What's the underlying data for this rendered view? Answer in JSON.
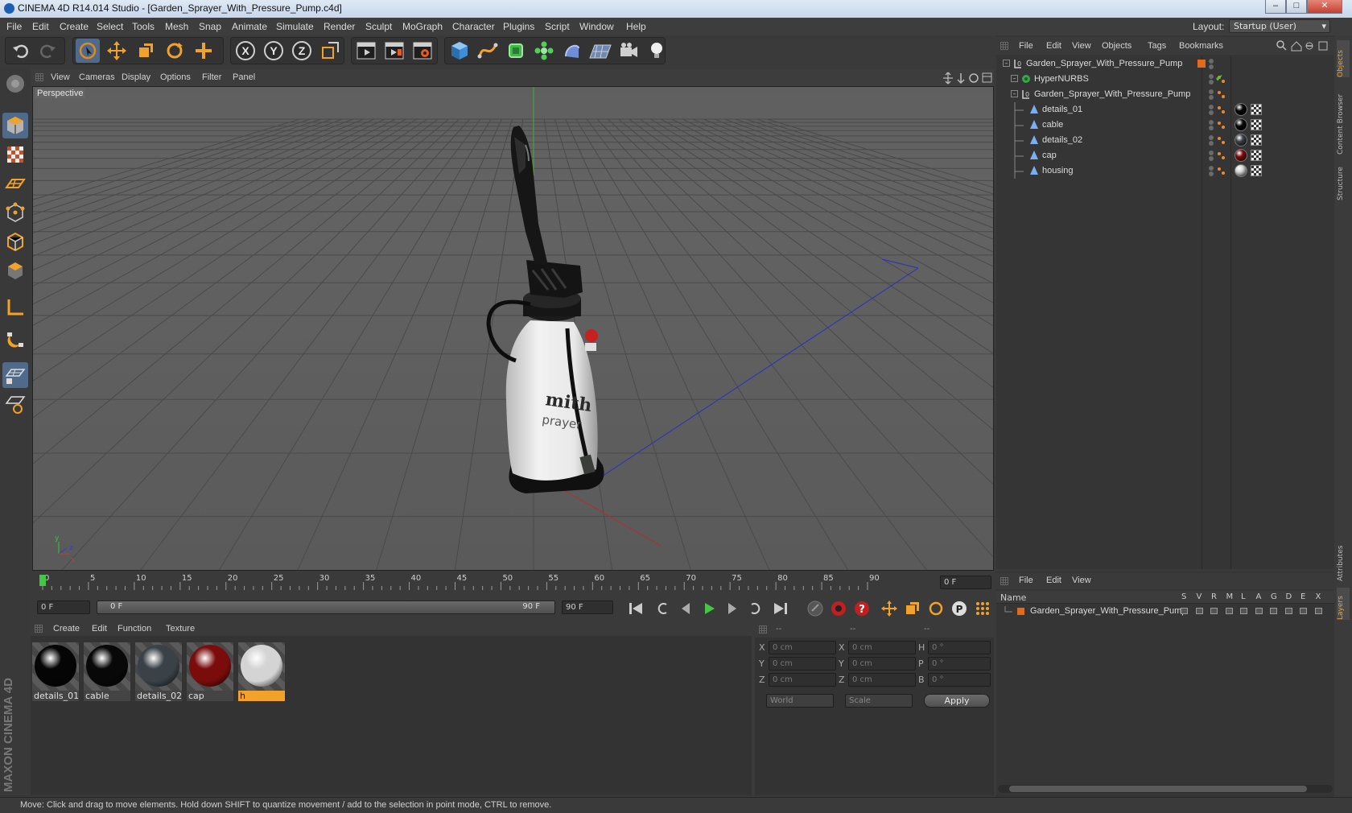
{
  "window": {
    "title": "CINEMA 4D R14.014 Studio - [Garden_Sprayer_With_Pressure_Pump.c4d]"
  },
  "menubar": {
    "items": [
      "File",
      "Edit",
      "Create",
      "Select",
      "Tools",
      "Mesh",
      "Snap",
      "Animate",
      "Simulate",
      "Render",
      "Sculpt",
      "MoGraph",
      "Character",
      "Plugins",
      "Script",
      "Window",
      "Help"
    ],
    "layout_label": "Layout:",
    "layout_value": "Startup (User)"
  },
  "toolbar": {
    "icons": [
      "undo-icon",
      "redo-icon",
      "live-selection-icon",
      "move-icon",
      "scale-icon",
      "rotate-icon",
      "add-icon",
      "x-axis-icon",
      "y-axis-icon",
      "z-axis-icon",
      "coordinate-system-icon",
      "render-view-icon",
      "render-picture-viewer-icon",
      "edit-render-settings-icon",
      "cube-icon",
      "spline-icon",
      "nurbs-icon",
      "array-icon",
      "deformer-icon",
      "floor-icon",
      "camera-icon",
      "light-icon"
    ],
    "axis_x": "X",
    "axis_y": "Y",
    "axis_z": "Z"
  },
  "viewport": {
    "menu": [
      "View",
      "Cameras",
      "Display",
      "Options",
      "Filter",
      "Panel"
    ],
    "label": "Perspective",
    "axis_y": "y",
    "axis_x": "x",
    "axis_z": "z",
    "product_text": "mith",
    "product_subtext": "prayer"
  },
  "timeline": {
    "ticks": [
      "0",
      "5",
      "10",
      "15",
      "20",
      "25",
      "30",
      "35",
      "40",
      "45",
      "50",
      "55",
      "60",
      "65",
      "70",
      "75",
      "80",
      "85",
      "90"
    ],
    "current_frame": "0 F"
  },
  "anim": {
    "start_field": "0 F",
    "range_start": "0 F",
    "range_end": "90 F",
    "end_field": "90 F",
    "param_button": "P"
  },
  "materials": {
    "menu": [
      "Create",
      "Edit",
      "Function",
      "Texture"
    ],
    "items": [
      {
        "name": "details_01",
        "color": "#050505"
      },
      {
        "name": "cable",
        "color": "#080808"
      },
      {
        "name": "details_02",
        "color": "#3a4248"
      },
      {
        "name": "cap",
        "color": "#7a0c0c"
      },
      {
        "name": "h",
        "color": "#d4d4d4"
      }
    ]
  },
  "coords": {
    "header": [
      "--",
      "--",
      "--"
    ],
    "rows": [
      {
        "a": "X",
        "av": "0 cm",
        "b": "X",
        "bv": "0 cm",
        "c": "H",
        "cv": "0 °"
      },
      {
        "a": "Y",
        "av": "0 cm",
        "b": "Y",
        "bv": "0 cm",
        "c": "P",
        "cv": "0 °"
      },
      {
        "a": "Z",
        "av": "0 cm",
        "b": "Z",
        "bv": "0 cm",
        "c": "B",
        "cv": "0 °"
      }
    ],
    "world": "World",
    "scale": "Scale",
    "apply": "Apply"
  },
  "objects": {
    "menu": [
      "File",
      "Edit",
      "View",
      "Objects",
      "Tags",
      "Bookmarks"
    ],
    "rows": [
      {
        "name": "Garden_Sprayer_With_Pressure_Pump",
        "type": "null",
        "tag": "#e06a1e"
      },
      {
        "name": "HyperNURBS",
        "type": "nurbs",
        "tag": "check"
      },
      {
        "name": "Garden_Sprayer_With_Pressure_Pump",
        "type": "null",
        "tag": ""
      },
      {
        "name": "details_01",
        "type": "poly",
        "material": "#050505"
      },
      {
        "name": "cable",
        "type": "poly",
        "material": "#080808"
      },
      {
        "name": "details_02",
        "type": "poly",
        "material": "#3a4248"
      },
      {
        "name": "cap",
        "type": "poly",
        "material": "#7a0c0c"
      },
      {
        "name": "housing",
        "type": "poly",
        "material": "#d4d4d4"
      }
    ]
  },
  "layers": {
    "menu": [
      "File",
      "Edit",
      "View"
    ],
    "col_name": "Name",
    "cols": [
      "S",
      "V",
      "R",
      "M",
      "L",
      "A",
      "G",
      "D",
      "E",
      "X"
    ],
    "row_name": "Garden_Sprayer_With_Pressure_Pump",
    "row_color": "#e06a1e"
  },
  "right_tabs": [
    "Objects",
    "Content Browser",
    "Structure",
    "Attributes",
    "Layers"
  ],
  "brand": {
    "text": "MAXON CINEMA 4D"
  },
  "status": {
    "text": "Move: Click and drag to move elements. Hold down SHIFT to quantize movement / add to the selection in point mode, CTRL to remove."
  }
}
